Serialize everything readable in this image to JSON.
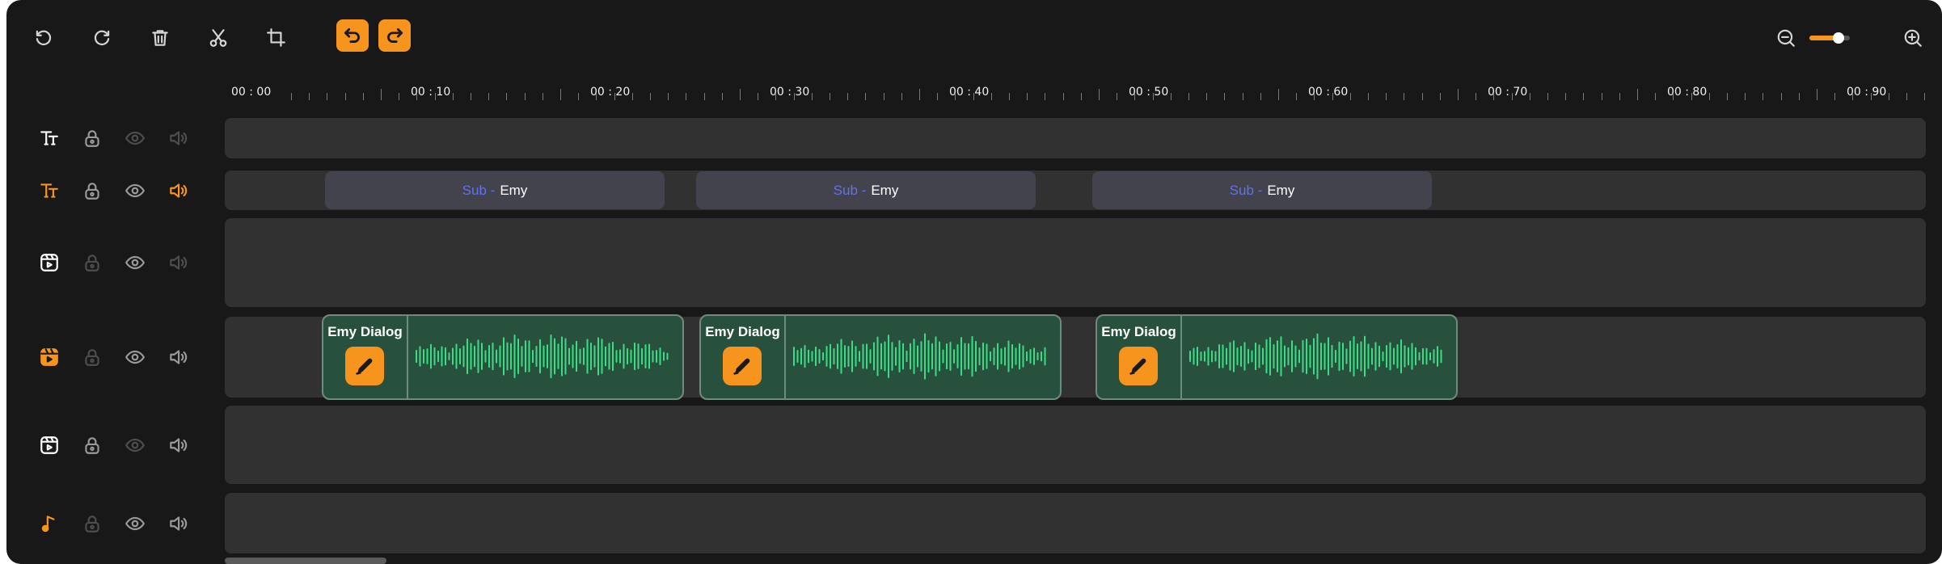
{
  "toolbar": {
    "tools": [
      {
        "name": "rotate-left-icon"
      },
      {
        "name": "rotate-right-icon"
      },
      {
        "name": "delete-icon"
      },
      {
        "name": "cut-icon"
      },
      {
        "name": "crop-icon"
      }
    ],
    "history": [
      {
        "name": "undo-icon",
        "color": "#f7941d"
      },
      {
        "name": "redo-icon",
        "color": "#f7941d"
      }
    ],
    "zoom": {
      "level": 0.72,
      "out_icon": "zoom-out-icon",
      "in_icon": "zoom-in-icon",
      "accent": "#f7941d"
    }
  },
  "ruler": {
    "labels": [
      "00 : 00",
      "00 : 10",
      "00 : 20",
      "00 : 30",
      "00 : 40",
      "00 : 50",
      "00 : 60",
      "00 : 70",
      "00 : 80",
      "00 : 90"
    ]
  },
  "tracks": [
    {
      "type": "text",
      "icon": "text-icon",
      "active": false,
      "lock": "unlocked",
      "visible": false,
      "audio": false
    },
    {
      "type": "subtitle",
      "icon": "text-icon",
      "active": true,
      "lock": "unlocked",
      "visible": true,
      "audio": true,
      "clips": [
        {
          "prefix": "Sub -",
          "name": "Emy"
        },
        {
          "prefix": "Sub -",
          "name": "Emy"
        },
        {
          "prefix": "Sub -",
          "name": "Emy"
        }
      ]
    },
    {
      "type": "video",
      "icon": "video-icon",
      "active": false,
      "lock": "disabled",
      "visible": true,
      "audio": false
    },
    {
      "type": "dialog",
      "icon": "video-icon",
      "active": true,
      "lock": "disabled",
      "visible": true,
      "audio": true,
      "clips": [
        {
          "title": "Emy Dialog",
          "edit_icon": "pencil-icon"
        },
        {
          "title": "Emy Dialog",
          "edit_icon": "pencil-icon"
        },
        {
          "title": "Emy Dialog",
          "edit_icon": "pencil-icon"
        }
      ]
    },
    {
      "type": "video",
      "icon": "video-icon",
      "active": false,
      "lock": "unlocked",
      "visible": false,
      "audio": true
    },
    {
      "type": "music",
      "icon": "music-note-icon",
      "active": true,
      "lock": "disabled",
      "visible": true,
      "audio": true
    }
  ],
  "colors": {
    "accent": "#f7941d",
    "wave": "#3ddc84",
    "subtitle_prefix": "#6372e6"
  }
}
